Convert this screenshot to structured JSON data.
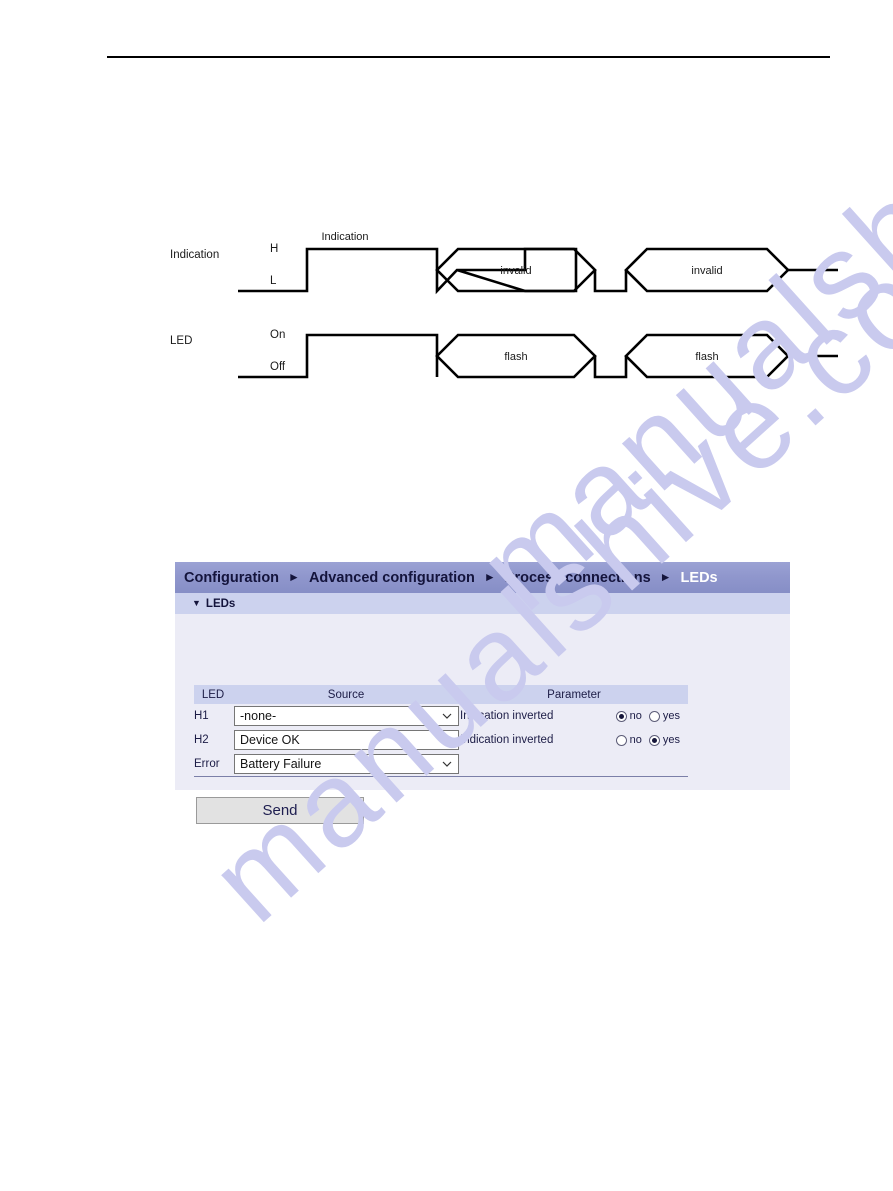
{
  "page": {
    "header_rule": true,
    "watermark_text": "manualshive.com",
    "watermark_color": "#c9caee"
  },
  "timing_diagram": {
    "rows": [
      {
        "name": "Indication",
        "high_label": "H",
        "low_label": "L",
        "pulse_label": "Indication",
        "invalid_label_1": "invalid",
        "invalid_label_2": "invalid"
      },
      {
        "name": "LED",
        "high_label": "On",
        "low_label": "Off",
        "pulse_label": "",
        "invalid_label_1": "flash",
        "invalid_label_2": "flash"
      }
    ]
  },
  "led_panel": {
    "breadcrumb": [
      "Configuration",
      "Advanced configuration",
      "Process connections",
      "LEDs"
    ],
    "breadcrumb_separator": "►",
    "section": {
      "caret": "▼",
      "title": "LEDs"
    },
    "table": {
      "headers": {
        "led": "LED",
        "source": "Source",
        "parameter": "Parameter"
      },
      "rows": [
        {
          "led": "H1",
          "source_value": "-none-",
          "param_label": "Indication inverted",
          "radio_no_label": "no",
          "radio_yes_label": "yes",
          "selected": "no"
        },
        {
          "led": "H2",
          "source_value": "Device OK",
          "param_label": "Indication inverted",
          "radio_no_label": "no",
          "radio_yes_label": "yes",
          "selected": "yes"
        },
        {
          "led": "Error",
          "source_value": "Battery Failure",
          "param_label": "",
          "radio_no_label": "",
          "radio_yes_label": "",
          "selected": ""
        }
      ]
    },
    "send_button": "Send",
    "colors": {
      "breadcrumb_bar": "#9097cd",
      "section_bar": "#ccd2ee",
      "panel_body": "#ececf6",
      "table_header": "#ccd2ee",
      "text_navy": "#14143c",
      "button_face": "#e2e2e2"
    }
  }
}
